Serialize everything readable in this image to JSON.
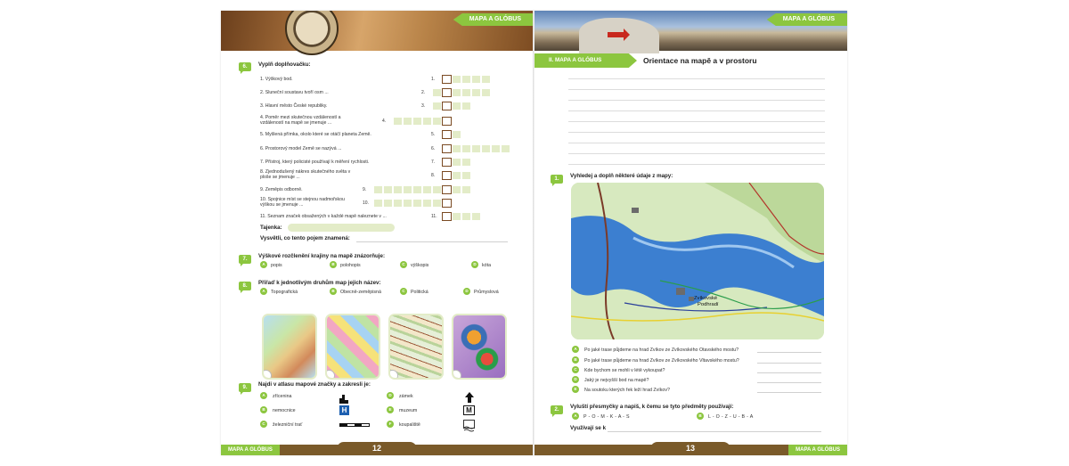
{
  "chapter_tag": "MAPA A GLÓBUS",
  "left_page": {
    "ex6": {
      "num": "6.",
      "title": "Vyplň doplňovačku:",
      "clues": [
        {
          "n": "1.",
          "text": "1. Výškový bod."
        },
        {
          "n": "2.",
          "text": "2. Sluneční soustavu tvoří osm ..."
        },
        {
          "n": "3.",
          "text": "3. Hlavní město České republiky."
        },
        {
          "n": "4.",
          "text": "4. Poměr mezi skutečnou vzdáleností a vzdáleností na mapě se jmenuje ..."
        },
        {
          "n": "5.",
          "text": "5. Myšlená přímka, okolo které se otáčí planeta Země."
        },
        {
          "n": "6.",
          "text": "6. Prostorový model Země se nazývá ..."
        },
        {
          "n": "7.",
          "text": "7. Přístroj, který policisté používají k měření rychlosti."
        },
        {
          "n": "8.",
          "text": "8. Zjednodušený nákres skutečného světa v ploše se jmenuje ..."
        },
        {
          "n": "9.",
          "text": "9. Zeměpis odborně."
        },
        {
          "n": "10.",
          "text": "10. Spojnice míst se stejnou nadmořskou výškou se jmenuje ..."
        },
        {
          "n": "11.",
          "text": "11. Seznam značek obsažených v každé mapě naleznete v ..."
        }
      ],
      "tajenka_label": "Tajenka:",
      "explain_label": "Vysvětli, co tento pojem znamená:"
    },
    "ex7": {
      "num": "7.",
      "title": "Výškové rozčlenění krajiny na mapě znázorňuje:",
      "options": [
        {
          "letter": "A",
          "text": "popis"
        },
        {
          "letter": "B",
          "text": "polohopis"
        },
        {
          "letter": "C",
          "text": "výškopis"
        },
        {
          "letter": "D",
          "text": "kóta"
        }
      ]
    },
    "ex8": {
      "num": "8.",
      "title": "Přiřaď k jednotlivým druhům map jejich název:",
      "options": [
        {
          "letter": "A",
          "text": "Topografická"
        },
        {
          "letter": "B",
          "text": "Obecně-zeměpisná"
        },
        {
          "letter": "C",
          "text": "Politická"
        },
        {
          "letter": "D",
          "text": "Průmyslová"
        }
      ]
    },
    "ex9": {
      "num": "9.",
      "title": "Najdi v atlasu mapové značky a zakresli je:",
      "items_left": [
        {
          "letter": "A",
          "text": "zřícenina"
        },
        {
          "letter": "B",
          "text": "nemocnice"
        },
        {
          "letter": "C",
          "text": "železniční trať"
        }
      ],
      "items_right": [
        {
          "letter": "D",
          "text": "zámek"
        },
        {
          "letter": "E",
          "text": "muzeum"
        },
        {
          "letter": "F",
          "text": "koupaliště"
        }
      ],
      "symbols": [
        "H",
        "M"
      ]
    },
    "page_number": "12"
  },
  "right_page": {
    "section_band": "II. MAPA A GLÓBUS",
    "section_title": "Orientace na mapě a v prostoru",
    "ex1": {
      "num": "1.",
      "title": "Vyhledej a doplň některé údaje z mapy:",
      "map_label_line1": "Zvíkovské",
      "map_label_line2": "Podhradí",
      "questions": [
        {
          "letter": "A",
          "text": "Po jaké trase půjdeme na hrad Zvíkov ze Zvíkovského Otavského mostu?"
        },
        {
          "letter": "B",
          "text": "Po jaké trase půjdeme na hrad Zvíkov ze Zvíkovského Vltavského mostu?"
        },
        {
          "letter": "C",
          "text": "Kde bychom se mohli v létě vykoupat?"
        },
        {
          "letter": "D",
          "text": "Jaký je nejvyšší bod na mapě?"
        },
        {
          "letter": "E",
          "text": "Na soutoku kterých řek leží hrad Zvíkov?"
        }
      ]
    },
    "ex2": {
      "num": "2.",
      "title": "Vyluští přesmyčky a napiš, k čemu se tyto předměty používají:",
      "anagrams": [
        {
          "letter": "A",
          "text": "P - O - M - K - A - S"
        },
        {
          "letter": "B",
          "text": "L - O - Z - U - B - A"
        }
      ],
      "use_label": "Využívají se k"
    },
    "page_number": "13"
  },
  "colors": {
    "accent": "#8cc63f",
    "brown": "#7a5a2a",
    "cell": "#e3ecc8"
  }
}
